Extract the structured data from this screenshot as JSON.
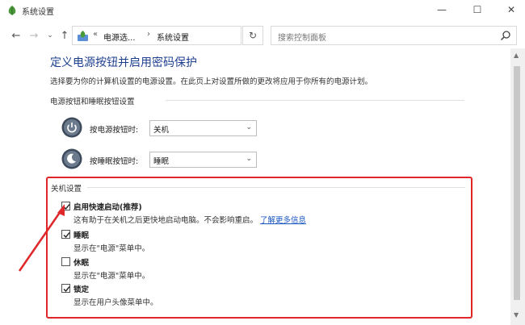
{
  "window": {
    "title": "系统设置",
    "minimize": "—",
    "maximize": "☐",
    "close": "✕"
  },
  "nav": {
    "back": "←",
    "forward": "→",
    "dropdown": "⌄",
    "up": "↑",
    "breadcrumb_sep": "«",
    "breadcrumb_1": "电源选...",
    "breadcrumb_chevron": "›",
    "breadcrumb_2": "系统设置",
    "refresh": "↻",
    "search_placeholder": "搜索控制面板"
  },
  "page": {
    "title": "定义电源按钮并启用密码保护",
    "description": "选择要为你的计算机设置的电源设置。在此页上对设置所做的更改将应用于你所有的电源计划。"
  },
  "power_buttons": {
    "section_title": "电源按钮和睡眠按钮设置",
    "power_label": "按电源按钮时:",
    "power_value": "关机",
    "sleep_label": "按睡眠按钮时:",
    "sleep_value": "睡眠"
  },
  "shutdown": {
    "section_title": "关机设置",
    "items": [
      {
        "label": "启用快速启动(推荐)",
        "checked": true,
        "desc": "这有助于在关机之后更快地启动电脑。不会影响重启。",
        "link": "了解更多信息"
      },
      {
        "label": "睡眠",
        "checked": true,
        "desc": "显示在\"电源\"菜单中。"
      },
      {
        "label": "休眠",
        "checked": false,
        "desc": "显示在\"电源\"菜单中。"
      },
      {
        "label": "锁定",
        "checked": true,
        "desc": "显示在用户头像菜单中。"
      }
    ]
  },
  "colors": {
    "title_blue": "#1e3f8f",
    "link_blue": "#1a56c4",
    "highlight_red": "#e0282a"
  }
}
